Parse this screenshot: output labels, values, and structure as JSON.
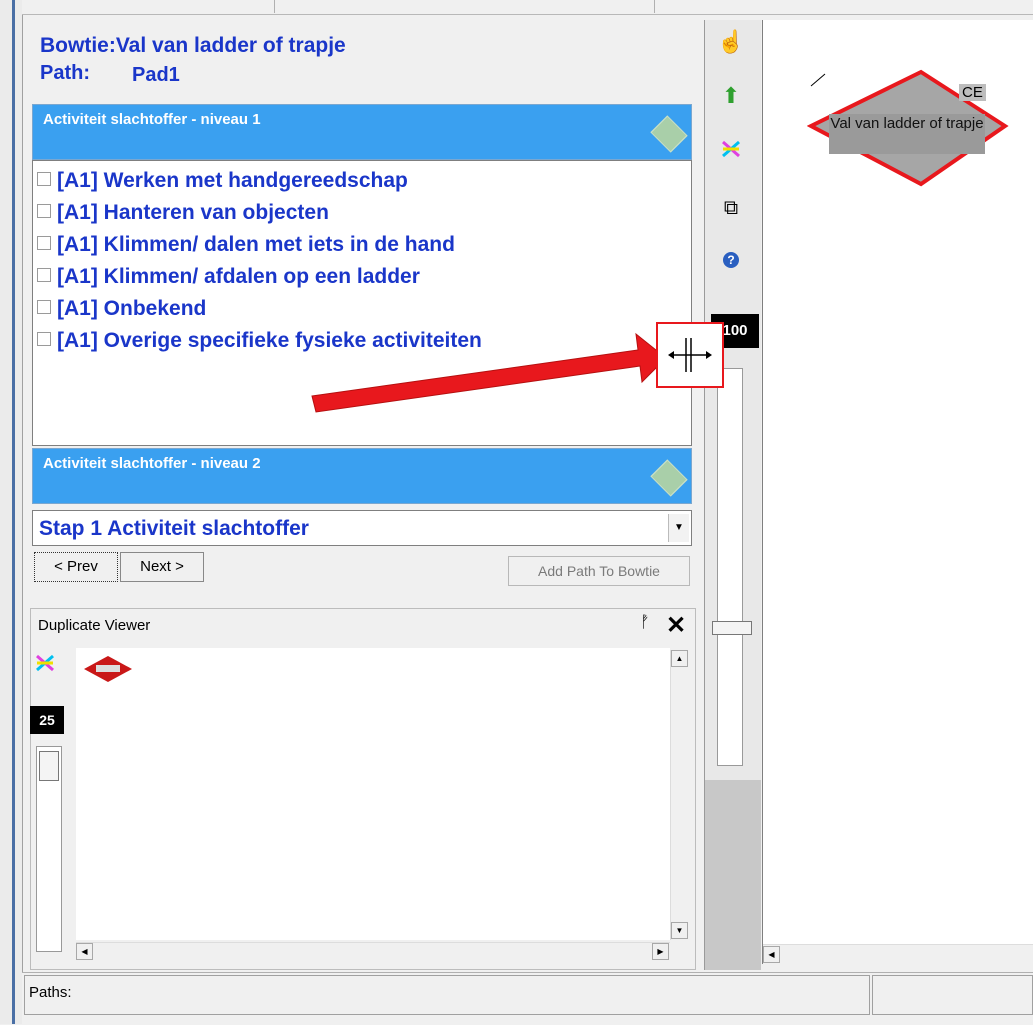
{
  "wizard": {
    "bowtie_label": "Bowtie:Val van ladder of trapje",
    "path_label": "Path:",
    "path_value": "Pad1",
    "level1_header": "Activiteit slachtoffer - niveau 1",
    "level2_header": "Activiteit slachtoffer - niveau 2",
    "items": [
      "[A1] Werken met handgereedschap",
      "[A1] Hanteren van objecten",
      "[A1] Klimmen/ dalen met iets in de hand",
      "[A1] Klimmen/ afdalen op een ladder",
      "[A1] Onbekend",
      "[A1] Overige specifieke fysieke activiteiten"
    ],
    "step_value": "Stap 1 Activiteit slachtoffer",
    "prev_label": "< Prev",
    "next_label": "Next >",
    "add_path_label": "Add Path To Bowtie"
  },
  "duplicate_viewer": {
    "title": "Duplicate Viewer",
    "zoom": "25",
    "pin_icon": "pin-icon",
    "close_icon": "close-icon"
  },
  "toolbar": {
    "zoom": "100",
    "icons": [
      "hand-icon",
      "up-arrow-icon",
      "layout-icon",
      "copy-icon",
      "help-icon"
    ]
  },
  "canvas": {
    "node_label": "Val van ladder of trapje",
    "node_tag": "CE",
    "colors": {
      "node_fill": "#a6a6a6",
      "node_border": "#e8181d"
    }
  },
  "status_bar": {
    "paths_label": "Paths:"
  },
  "annotation": {
    "arrow_color": "#e8181d",
    "cursor_icon": "resize-cursor-icon"
  }
}
